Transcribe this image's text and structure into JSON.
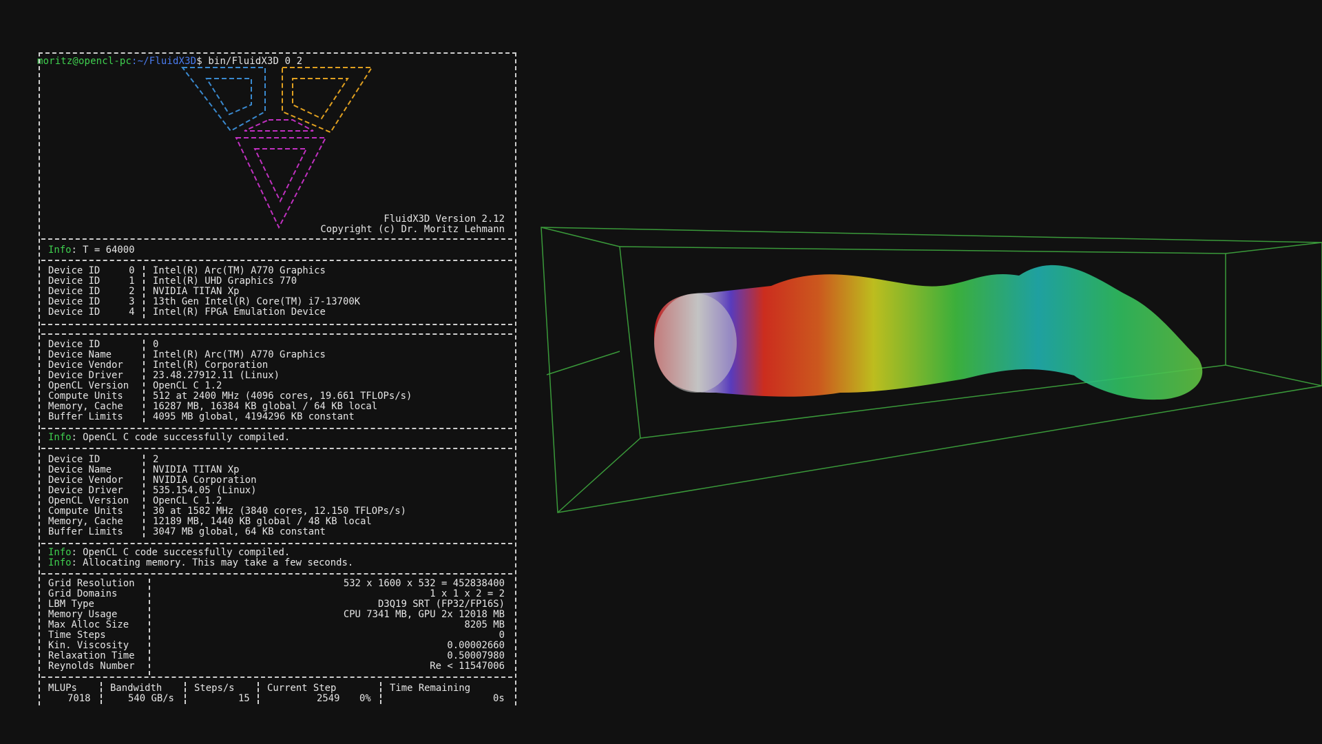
{
  "prompt": {
    "user_host": "moritz@opencl-pc",
    "path": ":~/FluidX3D",
    "command": "$ bin/FluidX3D 0 2"
  },
  "header": {
    "version": "FluidX3D Version 2.12",
    "copyright": "Copyright (c) Dr. Moritz Lehmann"
  },
  "info_t": {
    "label": "Info",
    "text": ": T = 64000"
  },
  "device_list": [
    {
      "label": "Device ID",
      "id": "0",
      "name": "Intel(R) Arc(TM) A770 Graphics"
    },
    {
      "label": "Device ID",
      "id": "1",
      "name": "Intel(R) UHD Graphics 770"
    },
    {
      "label": "Device ID",
      "id": "2",
      "name": "NVIDIA TITAN Xp"
    },
    {
      "label": "Device ID",
      "id": "3",
      "name": "13th Gen Intel(R) Core(TM) i7-13700K"
    },
    {
      "label": "Device ID",
      "id": "4",
      "name": "Intel(R) FPGA Emulation Device"
    }
  ],
  "device_a": [
    {
      "k": "Device ID",
      "v": "0"
    },
    {
      "k": "Device Name",
      "v": "Intel(R) Arc(TM) A770 Graphics"
    },
    {
      "k": "Device Vendor",
      "v": "Intel(R) Corporation"
    },
    {
      "k": "Device Driver",
      "v": "23.48.27912.11 (Linux)"
    },
    {
      "k": "OpenCL Version",
      "v": "OpenCL C 1.2"
    },
    {
      "k": "Compute Units",
      "v": "512 at 2400 MHz (4096 cores, 19.661 TFLOPs/s)"
    },
    {
      "k": "Memory, Cache",
      "v": "16287 MB, 16384 KB global / 64 KB local"
    },
    {
      "k": "Buffer Limits",
      "v": "4095 MB global, 4194296 KB constant"
    }
  ],
  "info_compiled_1": {
    "label": "Info",
    "text": ": OpenCL C code successfully compiled."
  },
  "device_b": [
    {
      "k": "Device ID",
      "v": "2"
    },
    {
      "k": "Device Name",
      "v": "NVIDIA TITAN Xp"
    },
    {
      "k": "Device Vendor",
      "v": "NVIDIA Corporation"
    },
    {
      "k": "Device Driver",
      "v": "535.154.05 (Linux)"
    },
    {
      "k": "OpenCL Version",
      "v": "OpenCL C 1.2"
    },
    {
      "k": "Compute Units",
      "v": "30 at 1582 MHz (3840 cores, 12.150 TFLOPs/s)"
    },
    {
      "k": "Memory, Cache",
      "v": "12189 MB, 1440 KB global / 48 KB local"
    },
    {
      "k": "Buffer Limits",
      "v": "3047 MB global, 64 KB constant"
    }
  ],
  "info_compiled_2": {
    "label": "Info",
    "text": ": OpenCL C code successfully compiled."
  },
  "info_alloc": {
    "label": "Info",
    "text": ": Allocating memory. This may take a few seconds."
  },
  "sim": [
    {
      "k": "Grid Resolution",
      "v": "532 x 1600 x 532 = 452838400"
    },
    {
      "k": "Grid Domains",
      "v": "1 x 1 x 2 = 2"
    },
    {
      "k": "LBM Type",
      "v": "D3Q19 SRT (FP32/FP16S)"
    },
    {
      "k": "Memory Usage",
      "v": "CPU 7341 MB, GPU 2x 12018 MB"
    },
    {
      "k": "Max Alloc Size",
      "v": "8205 MB"
    },
    {
      "k": "Time Steps",
      "v": "0"
    },
    {
      "k": "Kin. Viscosity",
      "v": "0.00002660"
    },
    {
      "k": "Relaxation Time",
      "v": "0.50007980"
    },
    {
      "k": "Reynolds Number",
      "v": "Re < 11547006"
    }
  ],
  "status": {
    "mlups_label": "MLUPs",
    "mlups": "7018",
    "bandwidth_label": "Bandwidth",
    "bandwidth": "540 GB/s",
    "steps_label": "Steps/s",
    "steps": "15",
    "current_label": "Current Step",
    "current": "2549",
    "percent": "0%",
    "remaining_label": "Time Remaining",
    "remaining": "0s"
  },
  "colors": {
    "prompt_green": "#3fd04f",
    "path_blue": "#4a7cf0",
    "logo_blue": "#3a8ad0",
    "logo_yellow": "#e0a020",
    "logo_magenta": "#c030c0",
    "bbox_green": "#3a9a3a"
  }
}
